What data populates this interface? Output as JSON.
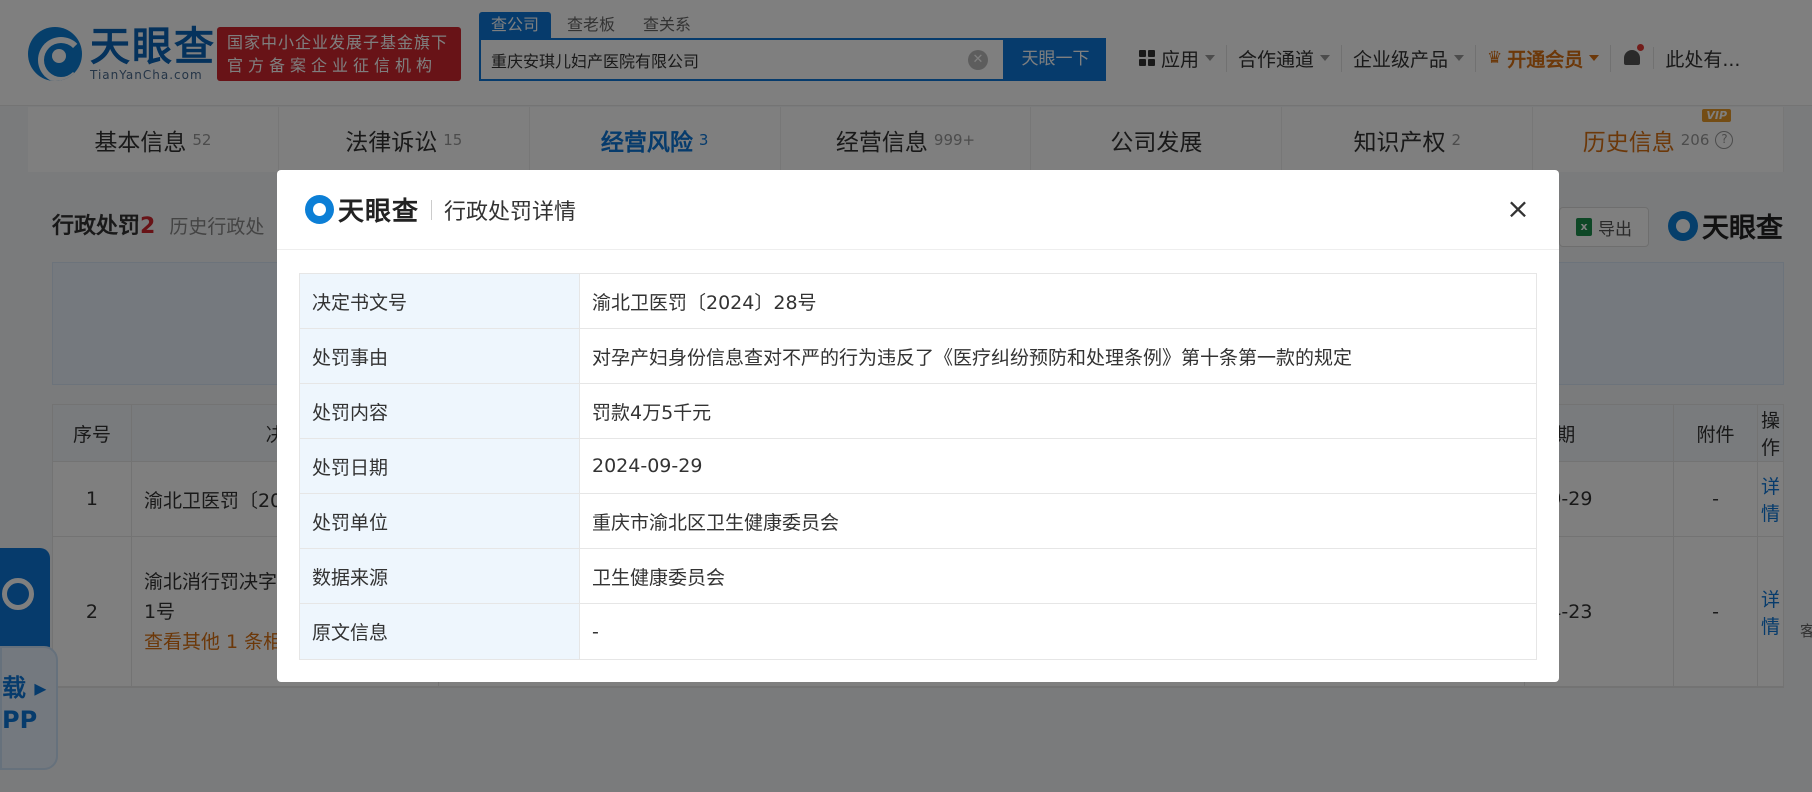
{
  "header": {
    "logo_cn": "天眼查",
    "logo_en": "TianYanCha.com",
    "fund_badge_line1": "国家中小企业发展子基金旗下",
    "fund_badge_line2": "官方备案企业征信机构",
    "search_tabs": [
      "查公司",
      "查老板",
      "查关系"
    ],
    "search_value": "重庆安琪儿妇产医院有限公司",
    "search_button": "天眼一下",
    "nav": {
      "apps": "应用",
      "channel": "合作通道",
      "enterprise": "企业级产品",
      "vip": "开通会员",
      "user": "此处有..."
    }
  },
  "tabs": [
    {
      "label": "基本信息",
      "count": "52"
    },
    {
      "label": "法律诉讼",
      "count": "15"
    },
    {
      "label": "经营风险",
      "count": "3"
    },
    {
      "label": "经营信息",
      "count": "999+"
    },
    {
      "label": "公司发展",
      "count": ""
    },
    {
      "label": "知识产权",
      "count": "2"
    },
    {
      "label": "历史信息",
      "count": "206",
      "tag": "VIP"
    }
  ],
  "section": {
    "title": "行政处罚",
    "count": "2",
    "subtitle": "历史行政处",
    "export_label": "导出",
    "export_icon": "x",
    "watermark": "天眼查"
  },
  "table": {
    "headers": {
      "no": "序号",
      "doc": "决定",
      "date": "日期",
      "attachment": "附件",
      "operation": "操作"
    },
    "rows": [
      {
        "no": "1",
        "doc": "渝北卫医罚〔20",
        "date": "09-29",
        "attachment": "-",
        "operation": "详情"
      },
      {
        "no": "2",
        "doc_line1": "渝北消行罚决字",
        "doc_line2": "1号",
        "doc_more": "查看其他 1 条相",
        "date": "04-23",
        "attachment": "-",
        "operation": "详情"
      }
    ]
  },
  "side": {
    "app_line1": "载 ▸",
    "app_line2": "PP",
    "right_edge": "客"
  },
  "modal": {
    "logo": "天眼查",
    "title": "行政处罚详情",
    "close": "×",
    "rows": [
      {
        "label": "决定书文号",
        "value": "渝北卫医罚〔2024〕28号"
      },
      {
        "label": "处罚事由",
        "value": "对孕产妇身份信息查对不严的行为违反了《医疗纠纷预防和处理条例》第十条第一款的规定"
      },
      {
        "label": "处罚内容",
        "value": "罚款4万5千元"
      },
      {
        "label": "处罚日期",
        "value": "2024-09-29"
      },
      {
        "label": "处罚单位",
        "value": "重庆市渝北区卫生健康委员会"
      },
      {
        "label": "数据来源",
        "value": "卫生健康委员会"
      },
      {
        "label": "原文信息",
        "value": "-"
      }
    ]
  },
  "colors": {
    "accent": "#0d77d9",
    "vip": "#d97013",
    "badge_red": "#d0262e",
    "label_bg": "#eef6fd"
  }
}
